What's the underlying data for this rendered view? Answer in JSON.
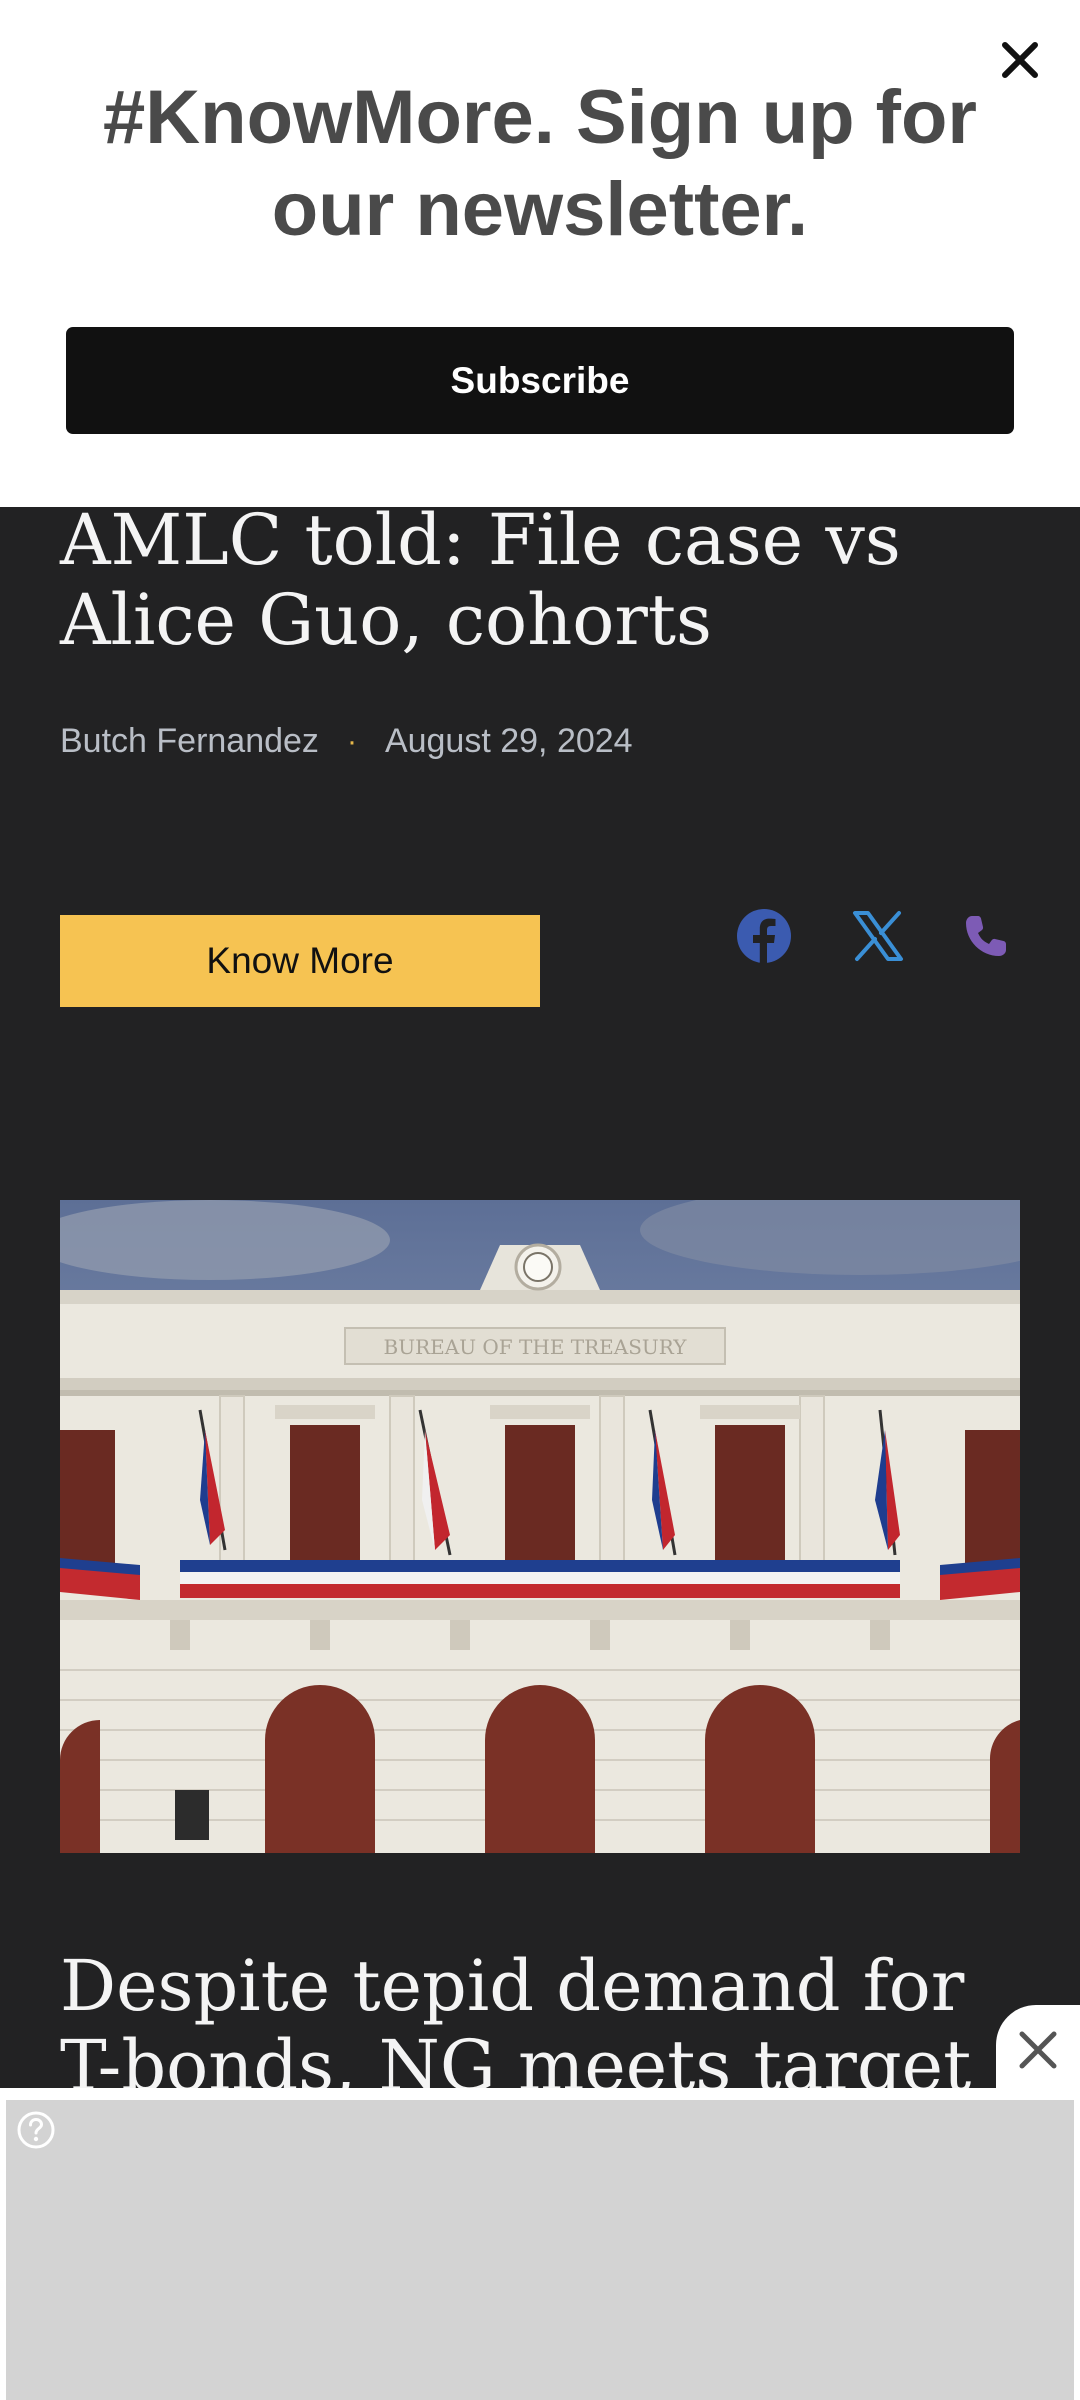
{
  "banner": {
    "title": "#KnowMore. Sign up for our newsletter.",
    "subscribe_label": "Subscribe",
    "close_icon": "close-icon"
  },
  "article1": {
    "headline": "AMLC told: File case vs Alice Guo, cohorts",
    "author": "Butch Fernandez",
    "separator": "·",
    "date": "August 29, 2024",
    "knowmore_label": "Know More",
    "share_icons": [
      "facebook-icon",
      "x-icon",
      "phone-icon"
    ]
  },
  "hero_image": {
    "sign_text": "BUREAU OF THE TREASURY"
  },
  "article2": {
    "headline": "Despite tepid demand for T-bonds, NG meets target"
  },
  "ad": {
    "help_icon": "help-icon",
    "close_icon": "close-icon"
  },
  "colors": {
    "page_bg": "#222223",
    "button_yellow": "#f6c352",
    "facebook": "#3b5bb0",
    "x_blue": "#3a8fd6",
    "phone_purple": "#7d5bb5"
  }
}
